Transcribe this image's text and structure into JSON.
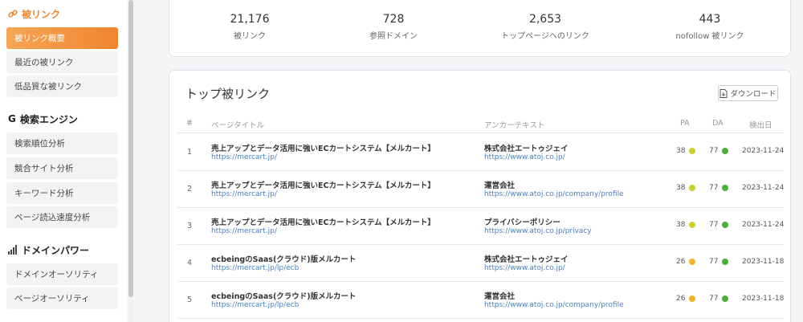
{
  "sidebar": {
    "sections": [
      {
        "title": "被リンク",
        "icon": "link-icon",
        "items": [
          {
            "label": "被リンク概要",
            "active": true
          },
          {
            "label": "最近の被リンク",
            "active": false
          },
          {
            "label": "低品質な被リンク",
            "active": false
          }
        ]
      },
      {
        "title": "検索エンジン",
        "icon": "google-icon",
        "items": [
          {
            "label": "検索順位分析",
            "active": false
          },
          {
            "label": "競合サイト分析",
            "active": false
          },
          {
            "label": "キーワード分析",
            "active": false
          },
          {
            "label": "ページ読込速度分析",
            "active": false
          }
        ]
      },
      {
        "title": "ドメインパワー",
        "icon": "signal-bars-icon",
        "items": [
          {
            "label": "ドメインオーソリティ",
            "active": false
          },
          {
            "label": "ページオーソリティ",
            "active": false
          }
        ]
      }
    ]
  },
  "stats": [
    {
      "value": "21,176",
      "label": "被リンク"
    },
    {
      "value": "728",
      "label": "参照ドメイン"
    },
    {
      "value": "2,653",
      "label": "トップページへのリンク"
    },
    {
      "value": "443",
      "label": "nofollow 被リンク"
    }
  ],
  "table": {
    "title": "トップ被リンク",
    "download_label": "ダウンロード",
    "headers": {
      "num": "#",
      "page_title": "ページタイトル",
      "anchor": "アンカーテキスト",
      "pa": "PA",
      "da": "DA",
      "date": "検出日"
    },
    "rows": [
      {
        "num": "1",
        "page_title": "売上アップとデータ活用に強いECカートシステム【メルカート】",
        "page_url": "https://mercart.jp/",
        "anchor": "株式会社エートゥジェイ",
        "anchor_url": "https://www.atoj.co.jp/",
        "pa": "38",
        "pa_color": "#c9cf2e",
        "da": "77",
        "da_color": "#4caf3c",
        "date": "2023-11-24"
      },
      {
        "num": "2",
        "page_title": "売上アップとデータ活用に強いECカートシステム【メルカート】",
        "page_url": "https://mercart.jp/",
        "anchor": "運営会社",
        "anchor_url": "https://www.atoj.co.jp/company/profile",
        "pa": "38",
        "pa_color": "#c9cf2e",
        "da": "77",
        "da_color": "#4caf3c",
        "date": "2023-11-24"
      },
      {
        "num": "3",
        "page_title": "売上アップとデータ活用に強いECカートシステム【メルカート】",
        "page_url": "https://mercart.jp/",
        "anchor": "プライバシーポリシー",
        "anchor_url": "https://www.atoj.co.jp/privacy",
        "pa": "38",
        "pa_color": "#c9cf2e",
        "da": "77",
        "da_color": "#4caf3c",
        "date": "2023-11-24"
      },
      {
        "num": "4",
        "page_title": "ecbeingのSaas(クラウド)版メルカート",
        "page_url": "https://mercart.jp/lp/ecb",
        "anchor": "株式会社エートゥジェイ",
        "anchor_url": "https://www.atoj.co.jp/",
        "pa": "26",
        "pa_color": "#f0b429",
        "da": "77",
        "da_color": "#4caf3c",
        "date": "2023-11-18"
      },
      {
        "num": "5",
        "page_title": "ecbeingのSaas(クラウド)版メルカート",
        "page_url": "https://mercart.jp/lp/ecb",
        "anchor": "運営会社",
        "anchor_url": "https://www.atoj.co.jp/company/profile",
        "pa": "26",
        "pa_color": "#f0b429",
        "da": "77",
        "da_color": "#4caf3c",
        "date": "2023-11-18"
      }
    ]
  }
}
